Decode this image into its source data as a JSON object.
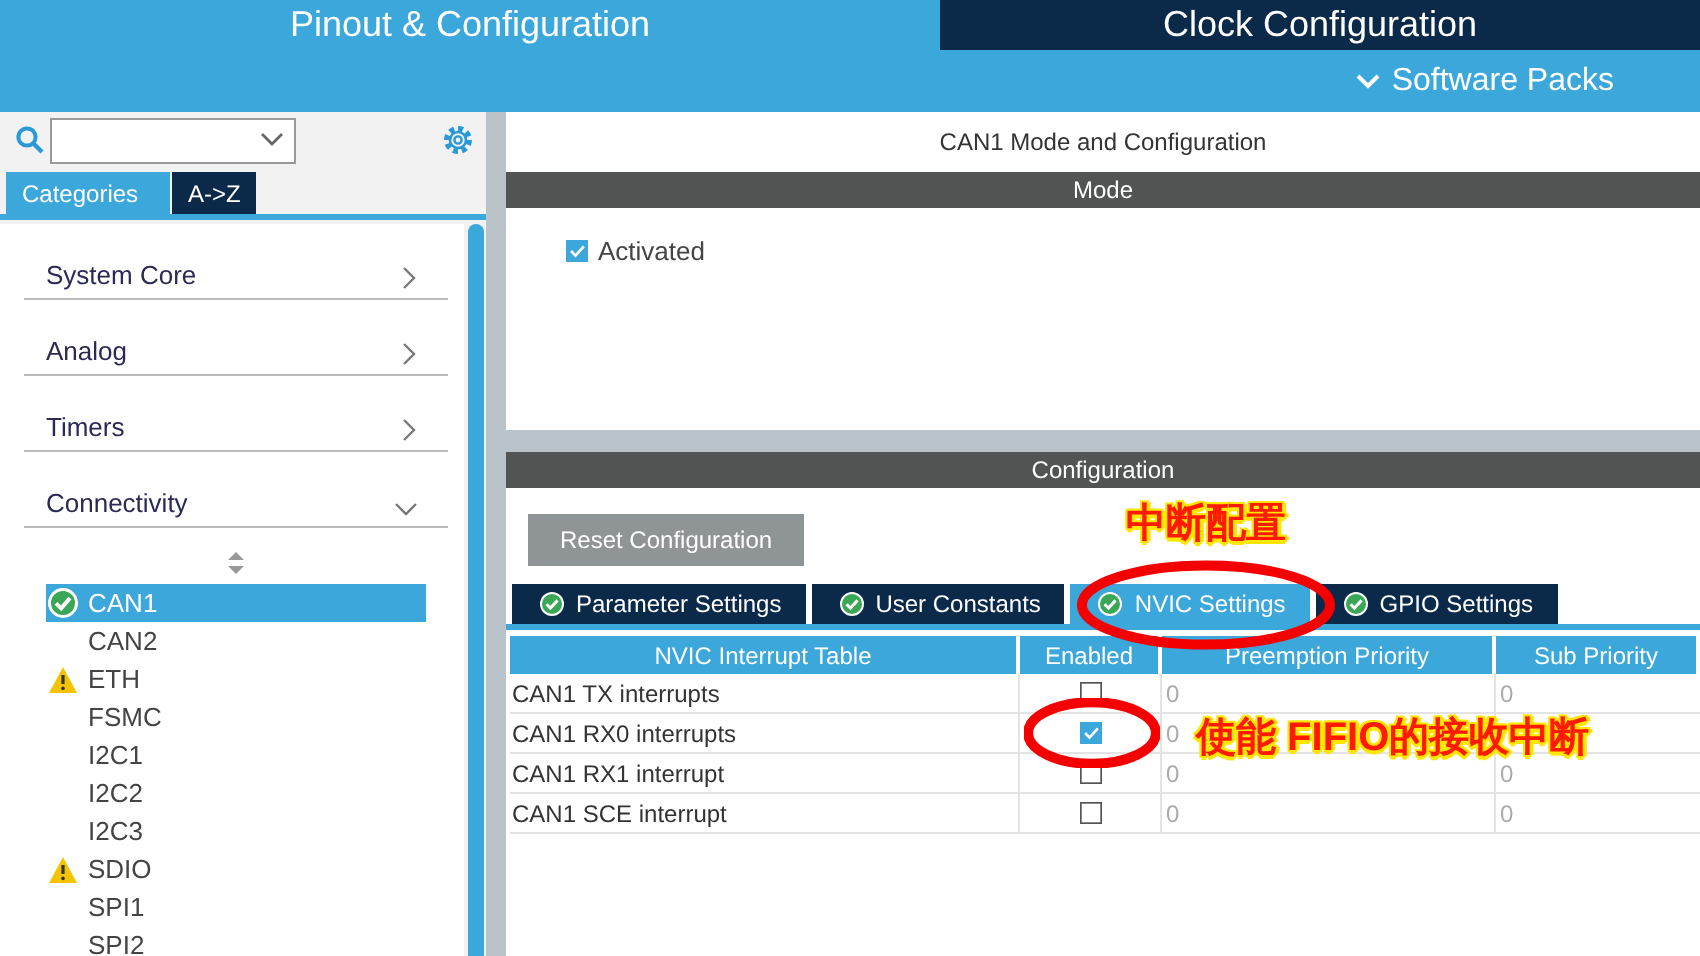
{
  "header": {
    "tabs": [
      {
        "label": "Pinout & Configuration",
        "selected": true
      },
      {
        "label": "Clock Configuration",
        "selected": false
      }
    ],
    "software_packs": "Software Packs"
  },
  "sidebar": {
    "tabs": [
      {
        "label": "Categories",
        "selected": true
      },
      {
        "label": "A->Z",
        "selected": false
      }
    ],
    "categories": [
      {
        "label": "System Core",
        "expanded": false
      },
      {
        "label": "Analog",
        "expanded": false
      },
      {
        "label": "Timers",
        "expanded": false
      },
      {
        "label": "Connectivity",
        "expanded": true
      }
    ],
    "items": [
      {
        "label": "CAN1",
        "kind": "ok",
        "selected": true
      },
      {
        "label": "CAN2",
        "kind": "plain",
        "selected": false
      },
      {
        "label": "ETH",
        "kind": "warning",
        "selected": false
      },
      {
        "label": "FSMC",
        "kind": "plain",
        "selected": false
      },
      {
        "label": "I2C1",
        "kind": "plain",
        "selected": false
      },
      {
        "label": "I2C2",
        "kind": "plain",
        "selected": false
      },
      {
        "label": "I2C3",
        "kind": "plain",
        "selected": false
      },
      {
        "label": "SDIO",
        "kind": "warning",
        "selected": false
      },
      {
        "label": "SPI1",
        "kind": "plain",
        "selected": false
      },
      {
        "label": "SPI2",
        "kind": "plain",
        "selected": false
      }
    ]
  },
  "panel": {
    "title": "CAN1 Mode and Configuration",
    "mode_header": "Mode",
    "activated": {
      "label": "Activated",
      "checked": true
    },
    "config_header": "Configuration",
    "reset_button": "Reset Configuration",
    "config_tabs": [
      {
        "label": "Parameter Settings",
        "selected": false
      },
      {
        "label": "User Constants",
        "selected": false
      },
      {
        "label": "NVIC Settings",
        "selected": true
      },
      {
        "label": "GPIO Settings",
        "selected": false
      }
    ],
    "table": {
      "columns": [
        "NVIC Interrupt Table",
        "Enabled",
        "Preemption Priority",
        "Sub Priority"
      ],
      "rows": [
        {
          "name": "CAN1 TX interrupts",
          "enabled": false,
          "preemption": "0",
          "sub": "0"
        },
        {
          "name": "CAN1 RX0 interrupts",
          "enabled": true,
          "preemption": "0"
        },
        {
          "name": "CAN1 RX1 interrupt",
          "enabled": false,
          "preemption": "0",
          "sub": "0"
        },
        {
          "name": "CAN1 SCE interrupt",
          "enabled": false,
          "preemption": "0",
          "sub": "0"
        }
      ]
    }
  },
  "annotations": [
    {
      "kind": "text",
      "text": "中断配置"
    },
    {
      "kind": "ellipse"
    },
    {
      "kind": "ellipse"
    },
    {
      "kind": "text",
      "text": "使能 FIFIO的接收中断"
    }
  ]
}
